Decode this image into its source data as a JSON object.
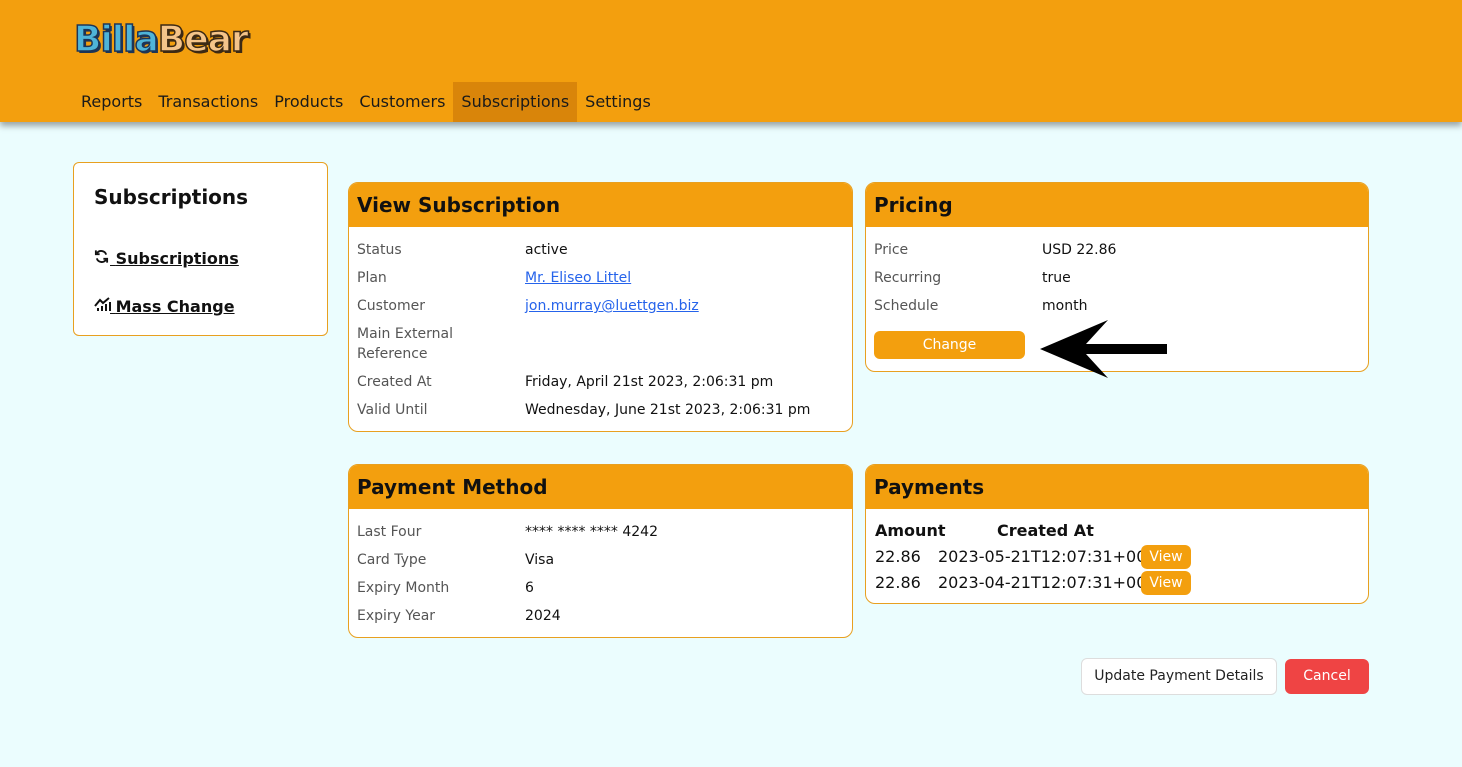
{
  "brand": {
    "part1": "Billa",
    "part2": "Bear"
  },
  "nav": [
    {
      "label": "Reports"
    },
    {
      "label": "Transactions"
    },
    {
      "label": "Products"
    },
    {
      "label": "Customers"
    },
    {
      "label": "Subscriptions",
      "active": true
    },
    {
      "label": "Settings"
    }
  ],
  "sidebar": {
    "title": "Subscriptions",
    "links": [
      {
        "label": "Subscriptions",
        "icon": "refresh-icon"
      },
      {
        "label": "Mass Change",
        "icon": "chart-icon"
      }
    ]
  },
  "view_subscription": {
    "title": "View Subscription",
    "rows": [
      {
        "key": "Status",
        "value": "active"
      },
      {
        "key": "Plan",
        "value": "Mr. Eliseo Littel",
        "link": true
      },
      {
        "key": "Customer",
        "value": "jon.murray@luettgen.biz",
        "link": true
      },
      {
        "key": "Main External Reference",
        "value": ""
      },
      {
        "key": "Created At",
        "value": "Friday, April 21st 2023, 2:06:31 pm"
      },
      {
        "key": "Valid Until",
        "value": "Wednesday, June 21st 2023, 2:06:31 pm"
      }
    ]
  },
  "pricing": {
    "title": "Pricing",
    "rows": [
      {
        "key": "Price",
        "value": "USD 22.86"
      },
      {
        "key": "Recurring",
        "value": "true"
      },
      {
        "key": "Schedule",
        "value": "month"
      }
    ],
    "change_label": "Change"
  },
  "payment_method": {
    "title": "Payment Method",
    "rows": [
      {
        "key": "Last Four",
        "value": "**** **** **** 4242"
      },
      {
        "key": "Card Type",
        "value": "Visa"
      },
      {
        "key": "Expiry Month",
        "value": "6"
      },
      {
        "key": "Expiry Year",
        "value": "2024"
      }
    ]
  },
  "payments": {
    "title": "Payments",
    "headers": [
      "Amount",
      "Created At"
    ],
    "rows": [
      {
        "amount": "22.86",
        "created_at": "2023-05-21T12:07:31+00:00",
        "action": "View"
      },
      {
        "amount": "22.86",
        "created_at": "2023-04-21T12:07:31+00:00",
        "action": "View"
      }
    ]
  },
  "actions": {
    "update_label": "Update Payment Details",
    "cancel_label": "Cancel"
  },
  "colors": {
    "accent": "#f39f0e",
    "accent_dark": "#d9850a",
    "background": "#ebfdfe",
    "danger": "#ef4444",
    "link": "#2563eb"
  }
}
